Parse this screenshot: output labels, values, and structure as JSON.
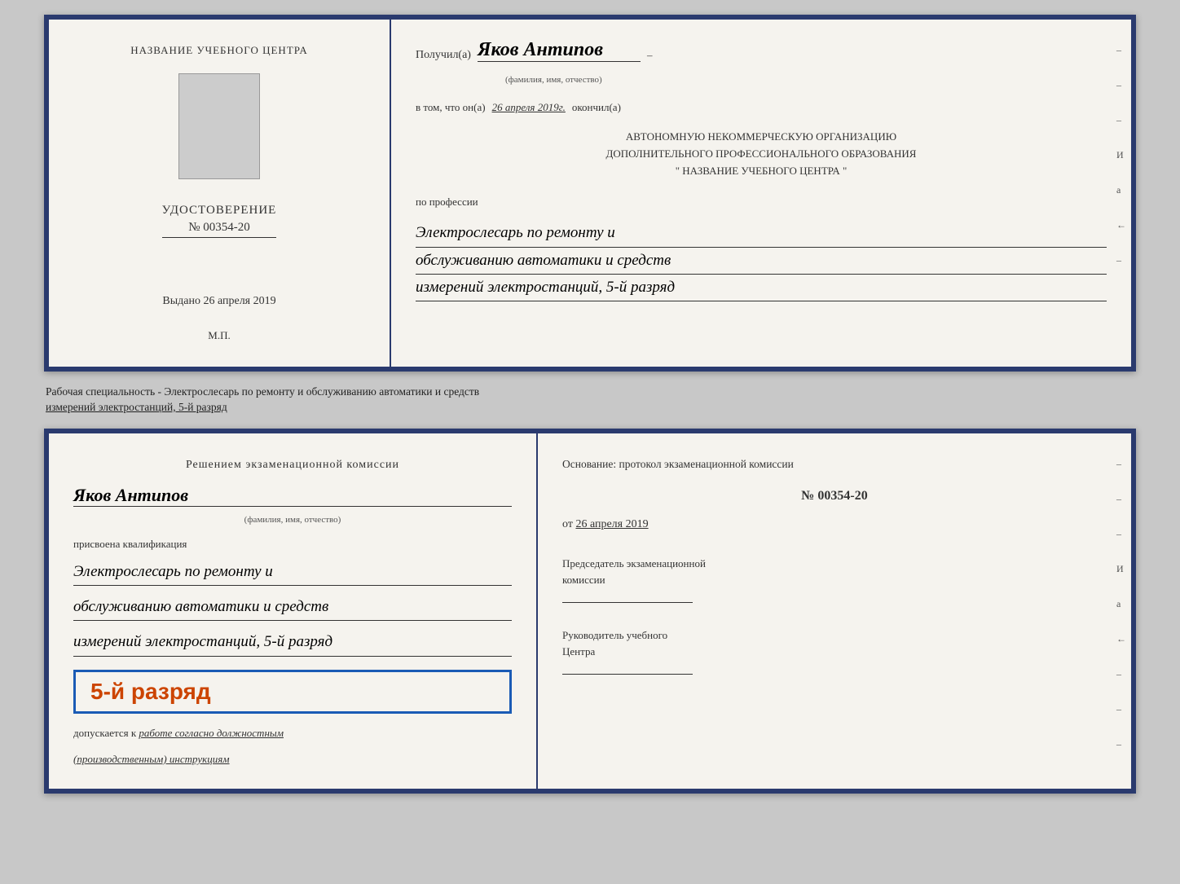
{
  "top_cert": {
    "left": {
      "training_center_label": "НАЗВАНИЕ УЧЕБНОГО ЦЕНТРА",
      "udost_label": "УДОСТОВЕРЕНИЕ",
      "number": "№ 00354-20",
      "vydano_label": "Выдано",
      "vydano_date": "26 апреля 2019",
      "mp_label": "М.П."
    },
    "right": {
      "poluchil_label": "Получил(а)",
      "name_handwritten": "Яков Антипов",
      "familiya_label": "(фамилия, имя, отчество)",
      "vtom_label": "в том, что он(а)",
      "vtom_date": "26 апреля 2019г.",
      "okonchil_label": "окончил(а)",
      "org_line1": "АВТОНОМНУЮ НЕКОММЕРЧЕСКУЮ ОРГАНИЗАЦИЮ",
      "org_line2": "ДОПОЛНИТЕЛЬНОГО ПРОФЕССИОНАЛЬНОГО ОБРАЗОВАНИЯ",
      "org_line3": "\"    НАЗВАНИЕ УЧЕБНОГО ЦЕНТРА    \"",
      "po_professii_label": "по профессии",
      "profession_line1": "Электрослесарь по ремонту и",
      "profession_line2": "обслуживанию автоматики и средств",
      "profession_line3": "измерений электростанций, 5-й разряд",
      "sidebar_marks": [
        "-",
        "-",
        "-",
        "И",
        "а",
        "←",
        "-"
      ]
    }
  },
  "middle": {
    "text_line1": "Рабочая специальность - Электрослесарь по ремонту и обслуживанию автоматики и средств",
    "text_line2": "измерений электростанций, 5-й разряд"
  },
  "bottom_cert": {
    "left": {
      "resheniem_label": "Решением  экзаменационной  комиссии",
      "name_handwritten": "Яков Антипов",
      "familiya_label": "(фамилия, имя, отчество)",
      "prisvoena_label": "присвоена квалификация",
      "profession_line1": "Электрослесарь по ремонту и",
      "profession_line2": "обслуживанию автоматики и средств",
      "profession_line3": "измерений электростанций, 5-й разряд",
      "rank_badge": "5-й разряд",
      "dopuskaetsya_label": "допускается к",
      "dopuskaetsya_text": "работе согласно должностным",
      "dopuskaetsya_text2": "(производственным) инструкциям"
    },
    "right": {
      "osnovanie_label": "Основание: протокол экзаменационной  комиссии",
      "number": "№  00354-20",
      "ot_label": "от",
      "ot_date": "26 апреля 2019",
      "predsed_label": "Председатель экзаменационной",
      "komissii_label": "комиссии",
      "ruk_label": "Руководитель учебного",
      "centra_label": "Центра",
      "sidebar_marks": [
        "-",
        "-",
        "-",
        "И",
        "а",
        "←",
        "-",
        "-",
        "-"
      ]
    }
  }
}
